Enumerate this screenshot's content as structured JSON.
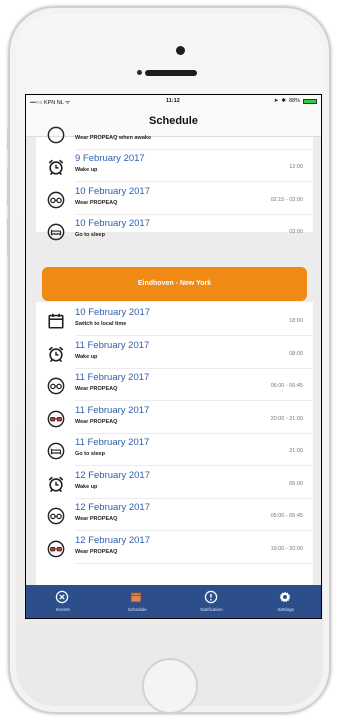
{
  "status_bar": {
    "carrier": "KPN NL",
    "time": "11:12",
    "battery": "88%"
  },
  "nav": {
    "title": "Schedule"
  },
  "partial_row": {
    "subtitle": "Wear PROPEAQ when awake"
  },
  "rows_top": [
    {
      "icon": "alarm-clock-icon",
      "date": "9 February 2017",
      "subtitle": "Wake up",
      "time": "12:00"
    },
    {
      "icon": "glasses-icon",
      "date": "10 February 2017",
      "subtitle": "Wear PROPEAQ",
      "time": "02:15 - 03:00"
    },
    {
      "icon": "sleep-icon",
      "date": "10 February 2017",
      "subtitle": "Go to sleep",
      "time": "03:00"
    }
  ],
  "route_button": {
    "label": "Eindhoven - New York"
  },
  "rows_bottom": [
    {
      "icon": "calendar-icon",
      "date": "10 February 2017",
      "subtitle": "Switch to local time",
      "time": "18:00"
    },
    {
      "icon": "alarm-clock-icon",
      "date": "11 February 2017",
      "subtitle": "Wake up",
      "time": "08:00"
    },
    {
      "icon": "glasses-icon",
      "date": "11 February 2017",
      "subtitle": "Wear PROPEAQ",
      "time": "06:00 - 06:45"
    },
    {
      "icon": "red-glasses-icon",
      "date": "11 February 2017",
      "subtitle": "Wear PROPEAQ",
      "time": "20:00 - 21:00"
    },
    {
      "icon": "sleep-icon",
      "date": "11 February 2017",
      "subtitle": "Go to sleep",
      "time": "21:00"
    },
    {
      "icon": "alarm-clock-icon",
      "date": "12 February 2017",
      "subtitle": "Wake up",
      "time": "05:00"
    },
    {
      "icon": "glasses-icon",
      "date": "12 February 2017",
      "subtitle": "Wear PROPEAQ",
      "time": "05:00 - 05:45"
    },
    {
      "icon": "red-glasses-icon",
      "date": "12 February 2017",
      "subtitle": "Wear PROPEAQ",
      "time": "19:00 - 20:00"
    }
  ],
  "tabs": [
    {
      "icon": "close-circle-icon",
      "label": "Events"
    },
    {
      "icon": "calendar-icon",
      "label": "Schedule",
      "active": true
    },
    {
      "icon": "info-circle-icon",
      "label": "Notification"
    },
    {
      "icon": "gear-icon",
      "label": "Settings"
    }
  ],
  "colors": {
    "accent_orange": "#ef8a14",
    "tab_bar_blue": "#2c4f8c",
    "link_blue": "#2d5fae",
    "red_glasses": "#c0392b"
  }
}
